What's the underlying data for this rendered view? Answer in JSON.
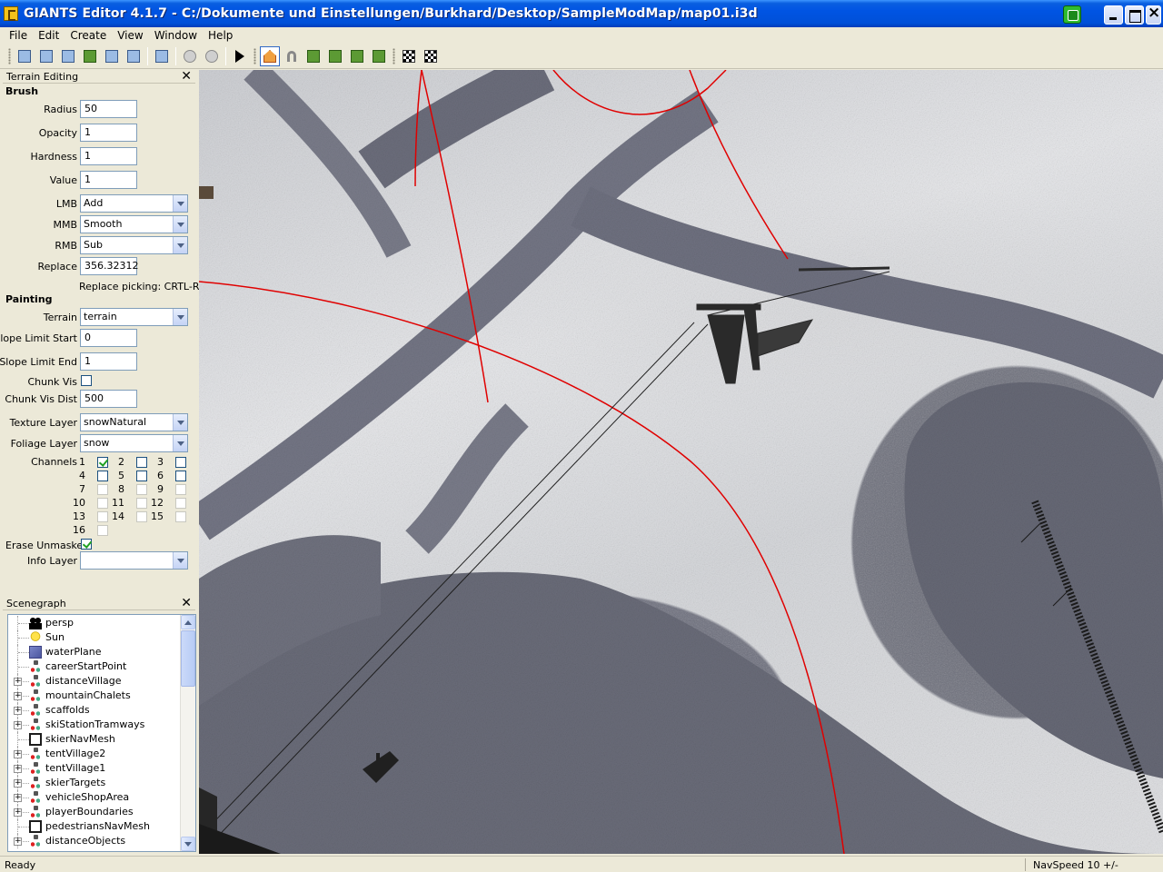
{
  "window": {
    "title": "GIANTS Editor 4.1.7 - C:/Dokumente und Einstellungen/Burkhard/Desktop/SampleModMap/map01.i3d"
  },
  "menu": [
    "File",
    "Edit",
    "Create",
    "View",
    "Window",
    "Help"
  ],
  "terrain_panel": {
    "title": "Terrain Editing",
    "brush_section": "Brush",
    "radius_label": "Radius",
    "radius_value": "50",
    "opacity_label": "Opacity",
    "opacity_value": "1",
    "hardness_label": "Hardness",
    "hardness_value": "1",
    "value_label": "Value",
    "value_value": "1",
    "lmb_label": "LMB",
    "lmb_value": "Add",
    "mmb_label": "MMB",
    "mmb_value": "Smooth",
    "rmb_label": "RMB",
    "rmb_value": "Sub",
    "replace_label": "Replace",
    "replace_value": "356.32312",
    "replace_note": "Replace picking: CRTL-R",
    "painting_section": "Painting",
    "terrain_label": "Terrain",
    "terrain_value": "terrain",
    "slope_start_label": "Slope Limit Start",
    "slope_start_value": "0",
    "slope_end_label": "Slope Limit End",
    "slope_end_value": "1",
    "chunk_vis_label": "Chunk Vis",
    "chunk_vis_dist_label": "Chunk Vis Dist",
    "chunk_vis_dist_value": "500",
    "texture_layer_label": "Texture Layer",
    "texture_layer_value": "snowNatural",
    "foliage_layer_label": "Foliage Layer",
    "foliage_layer_value": "snow",
    "channels_label": "Channels",
    "channels": [
      {
        "n": "1",
        "checked": true
      },
      {
        "n": "2",
        "checked": false
      },
      {
        "n": "3",
        "checked": false
      },
      {
        "n": "4",
        "checked": false
      },
      {
        "n": "5",
        "checked": false
      },
      {
        "n": "6",
        "checked": false
      },
      {
        "n": "7",
        "checked": false
      },
      {
        "n": "8",
        "checked": false
      },
      {
        "n": "9",
        "checked": false
      },
      {
        "n": "10",
        "checked": false
      },
      {
        "n": "11",
        "checked": false
      },
      {
        "n": "12",
        "checked": false
      },
      {
        "n": "13",
        "checked": false
      },
      {
        "n": "14",
        "checked": false
      },
      {
        "n": "15",
        "checked": false
      },
      {
        "n": "16",
        "checked": false
      }
    ],
    "erase_unmasked_label": "Erase Unmasked",
    "erase_unmasked_checked": true,
    "info_layer_label": "Info Layer",
    "info_layer_value": ""
  },
  "scenegraph": {
    "title": "Scenegraph",
    "nodes": [
      {
        "label": "persp",
        "icon": "camera-icon",
        "expandable": false
      },
      {
        "label": "Sun",
        "icon": "light-bulb-icon",
        "expandable": false
      },
      {
        "label": "waterPlane",
        "icon": "water-plane-icon",
        "expandable": false
      },
      {
        "label": "careerStartPoint",
        "icon": "transform-group-icon",
        "expandable": false
      },
      {
        "label": "distanceVillage",
        "icon": "transform-group-icon",
        "expandable": true
      },
      {
        "label": "mountainChalets",
        "icon": "transform-group-icon",
        "expandable": true
      },
      {
        "label": "scaffolds",
        "icon": "transform-group-icon",
        "expandable": true
      },
      {
        "label": "skiStationTramways",
        "icon": "transform-group-icon",
        "expandable": true
      },
      {
        "label": "skierNavMesh",
        "icon": "navmesh-icon",
        "expandable": false
      },
      {
        "label": "tentVillage2",
        "icon": "transform-group-icon",
        "expandable": true
      },
      {
        "label": "tentVillage1",
        "icon": "transform-group-icon",
        "expandable": true
      },
      {
        "label": "skierTargets",
        "icon": "transform-group-icon",
        "expandable": true
      },
      {
        "label": "vehicleShopArea",
        "icon": "transform-group-icon",
        "expandable": true
      },
      {
        "label": "playerBoundaries",
        "icon": "transform-group-icon",
        "expandable": true
      },
      {
        "label": "pedestriansNavMesh",
        "icon": "navmesh-icon",
        "expandable": false
      },
      {
        "label": "distanceObjects",
        "icon": "transform-group-icon",
        "expandable": true
      }
    ]
  },
  "status": {
    "left": "Ready",
    "right": "NavSpeed 10 +/-"
  },
  "colors": {
    "titlebar": "#0054e3",
    "chrome": "#ece9d8",
    "gizmo_red": "#e00000"
  }
}
